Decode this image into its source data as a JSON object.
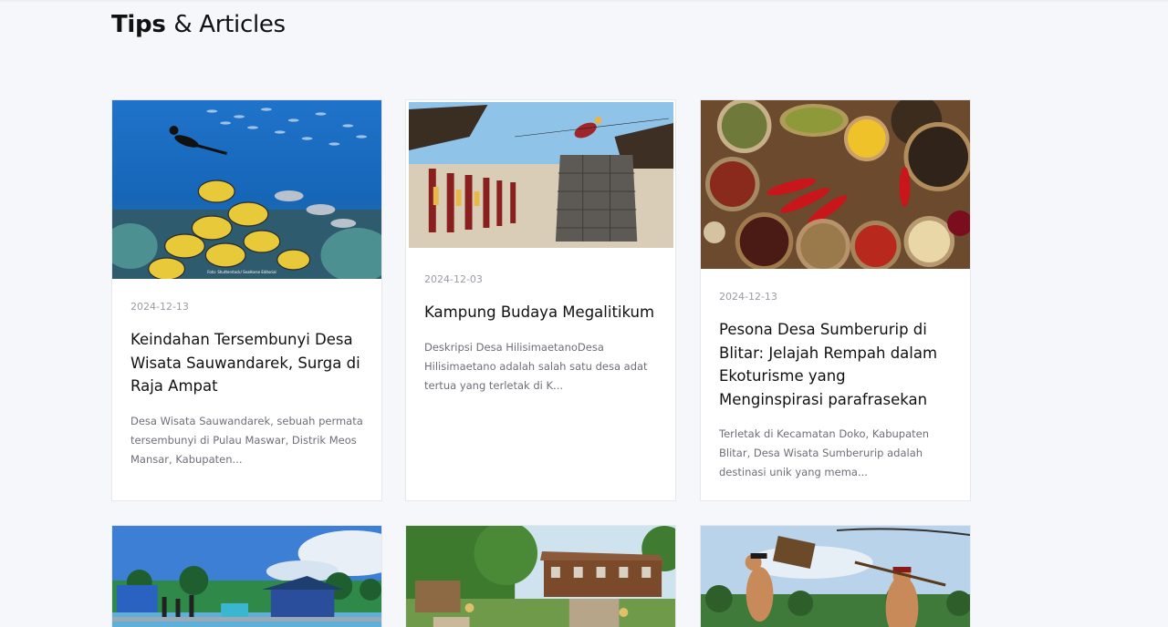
{
  "section": {
    "title_bold": "Tips",
    "title_rest": "& Articles"
  },
  "articles": [
    {
      "image": "underwater-fish-image",
      "image_caption": "Foto: Shutterstock/ SeaHorse Editorial",
      "date": "2024-12-13",
      "title": "Keindahan Tersembunyi Desa Wisata Sauwandarek, Surga di Raja Ampat",
      "excerpt": "Desa Wisata Sauwandarek, sebuah permata tersembunyi di Pulau Maswar, Distrik Meos Mansar, Kabupaten..."
    },
    {
      "image": "stone-jumping-village-image",
      "date": "2024-12-03",
      "title": "Kampung Budaya Megalitikum",
      "excerpt": "Deskripsi Desa HilisimaetanoDesa Hilisimaetano adalah salah satu desa adat tertua yang terletak di K..."
    },
    {
      "image": "spices-bowls-image",
      "date": "2024-12-13",
      "title": "Pesona Desa Sumberurip di Blitar: Jelajah Rempah dalam Ekoturisme yang Menginspirasi parafrasekan",
      "excerpt": "Terletak di Kecamatan Doko, Kabupaten Blitar, Desa Wisata Sumberurip adalah destinasi unik yang mema..."
    },
    {
      "image": "pier-huts-sea-image"
    },
    {
      "image": "wooden-houses-garden-image"
    },
    {
      "image": "traditional-fighters-image"
    }
  ],
  "colors": {
    "background": "#f6f7fb",
    "card": "#ffffff",
    "card_border": "#e6e8ee",
    "date_text": "#9a9ca3",
    "excerpt_text": "#6d6f76"
  }
}
